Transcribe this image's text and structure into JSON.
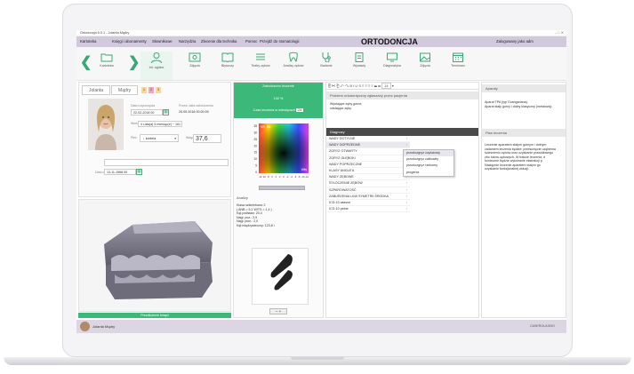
{
  "window": {
    "title": "Ortodoncja 6.0.1 - Jolanta Mądry"
  },
  "menu": {
    "items": [
      "Kartoteka",
      "Księgi i abonamenty",
      "Słownikowe",
      "Narzędzia",
      "Zlecenie dla technika",
      "Pomoc",
      "Przejdź do stomatologii"
    ],
    "brand": "ORTODONCJA",
    "user": "Zalogowany jako adm"
  },
  "toolbar": {
    "items": [
      "Kartoteka",
      "Inf. ogólne",
      "Zdjęcia",
      "Błyszczy",
      "Teatry zębów",
      "Analizy zębów",
      "Badanie",
      "Wywiady",
      "Diagnostyka",
      "Zdjęcia",
      "Terminarz"
    ]
  },
  "patient": {
    "first_name": "Jolanta",
    "last_name": "Mądry",
    "codes": [
      "1",
      "2",
      "3"
    ],
    "date_label": "Data rozpoczęcia",
    "date_value": "22-02-2018 00",
    "plan_label": "Przew. data zakończenia",
    "plan_value": "25.05.2018 00:00:00",
    "age_label": "Wiek",
    "age_value": "4 Lata(a) 5 miesiąc(e)  ~ 161",
    "sex_label": "Płeć",
    "sex_value": "kobieta",
    "weight_label": "Waga",
    "weight_value": "37,6",
    "birth_label": "Data ur.",
    "birth_value": "13-11-1968 00"
  },
  "midcol": {
    "header": "Zakończono leczenie",
    "percent": "100 %",
    "duration_label": "Czas leczenia w miesiącach",
    "duration_value": "24",
    "analysis_title": "Analizy",
    "stats": [
      "Klasa szkieletowa: 2",
      "( ANB = 5,1 WITS = 1,4 )",
      "Kąt podstaw: 20,4",
      "Nagi. poz.: 2,9",
      "Nagi. pion.: 2,0",
      "Kąt międzysieczny: 123,8 i"
    ]
  },
  "chart_data": {
    "type": "heatmap",
    "title": "",
    "x_labels": [
      "12",
      "10",
      "8",
      "6",
      "4",
      "2",
      "0",
      "-2",
      "-4",
      "-6",
      "-8",
      "-10",
      "-12"
    ],
    "y_labels": [
      "35",
      "30",
      "25",
      "20",
      "15",
      "10",
      "5",
      "0"
    ],
    "corner_labels": [
      "MR, INL",
      "Wits"
    ]
  },
  "rightcol": {
    "problem_header": "Problem ortodontyczny zgłaszany przez pacjenta",
    "problem_text": [
      "Wystające zęby górne,",
      "odstające zęby."
    ],
    "diagnosis_header": "Diagnozy",
    "items": [
      "WADY DOTYLNE",
      "WADY DOPRZEDNE",
      "ZGRYZ OTWARTY",
      "ZGRYZ GŁĘBOKI",
      "WADY POPRZECZNE",
      "KLASY ANGLE'A",
      "WADY ZĘBOWE",
      "STŁOCZENIE ZĘBÓW",
      "SZPAROWATOŚĆ",
      "ZABURZENIA LINII SYMETRII ŚRODKA",
      "ICD-10 własne",
      "ICD-10 pełne"
    ],
    "submenu": [
      "przodozgryz częściowy",
      "przodozgryz całkowity",
      "przodozgryz rzekomy",
      "progenia"
    ],
    "font_size": "14"
  },
  "farcol": {
    "aparaty_header": "Aparaty",
    "aparaty_text": [
      "Aparat TPA (typ Goshgariana).",
      "Aparat stały górny i dolny klasyczny (metalowy)."
    ],
    "plan_header": "Plan leczenia",
    "plan_text": [
      "Leczenie aparatem stałym górnym i dolnym",
      "zadaniem leczenia będzie: przesunięcie uzębienia",
      "ścieśnieniu zębów oraz uzyskanie prawidłowego",
      "zbo łuków zębowych. W trakcie leczenia, d",
      "konieczne będzie wykonanie ekstrakcji p",
      "Następnie leczenie aparatem stałym go",
      "uzyskanie funkcjonalnej okluzji."
    ]
  },
  "status": {
    "left_name": "Jolanta Mądry",
    "right": "CASEROLAGNO"
  },
  "greenbar": {
    "label": "Przedłużenie terapii"
  }
}
